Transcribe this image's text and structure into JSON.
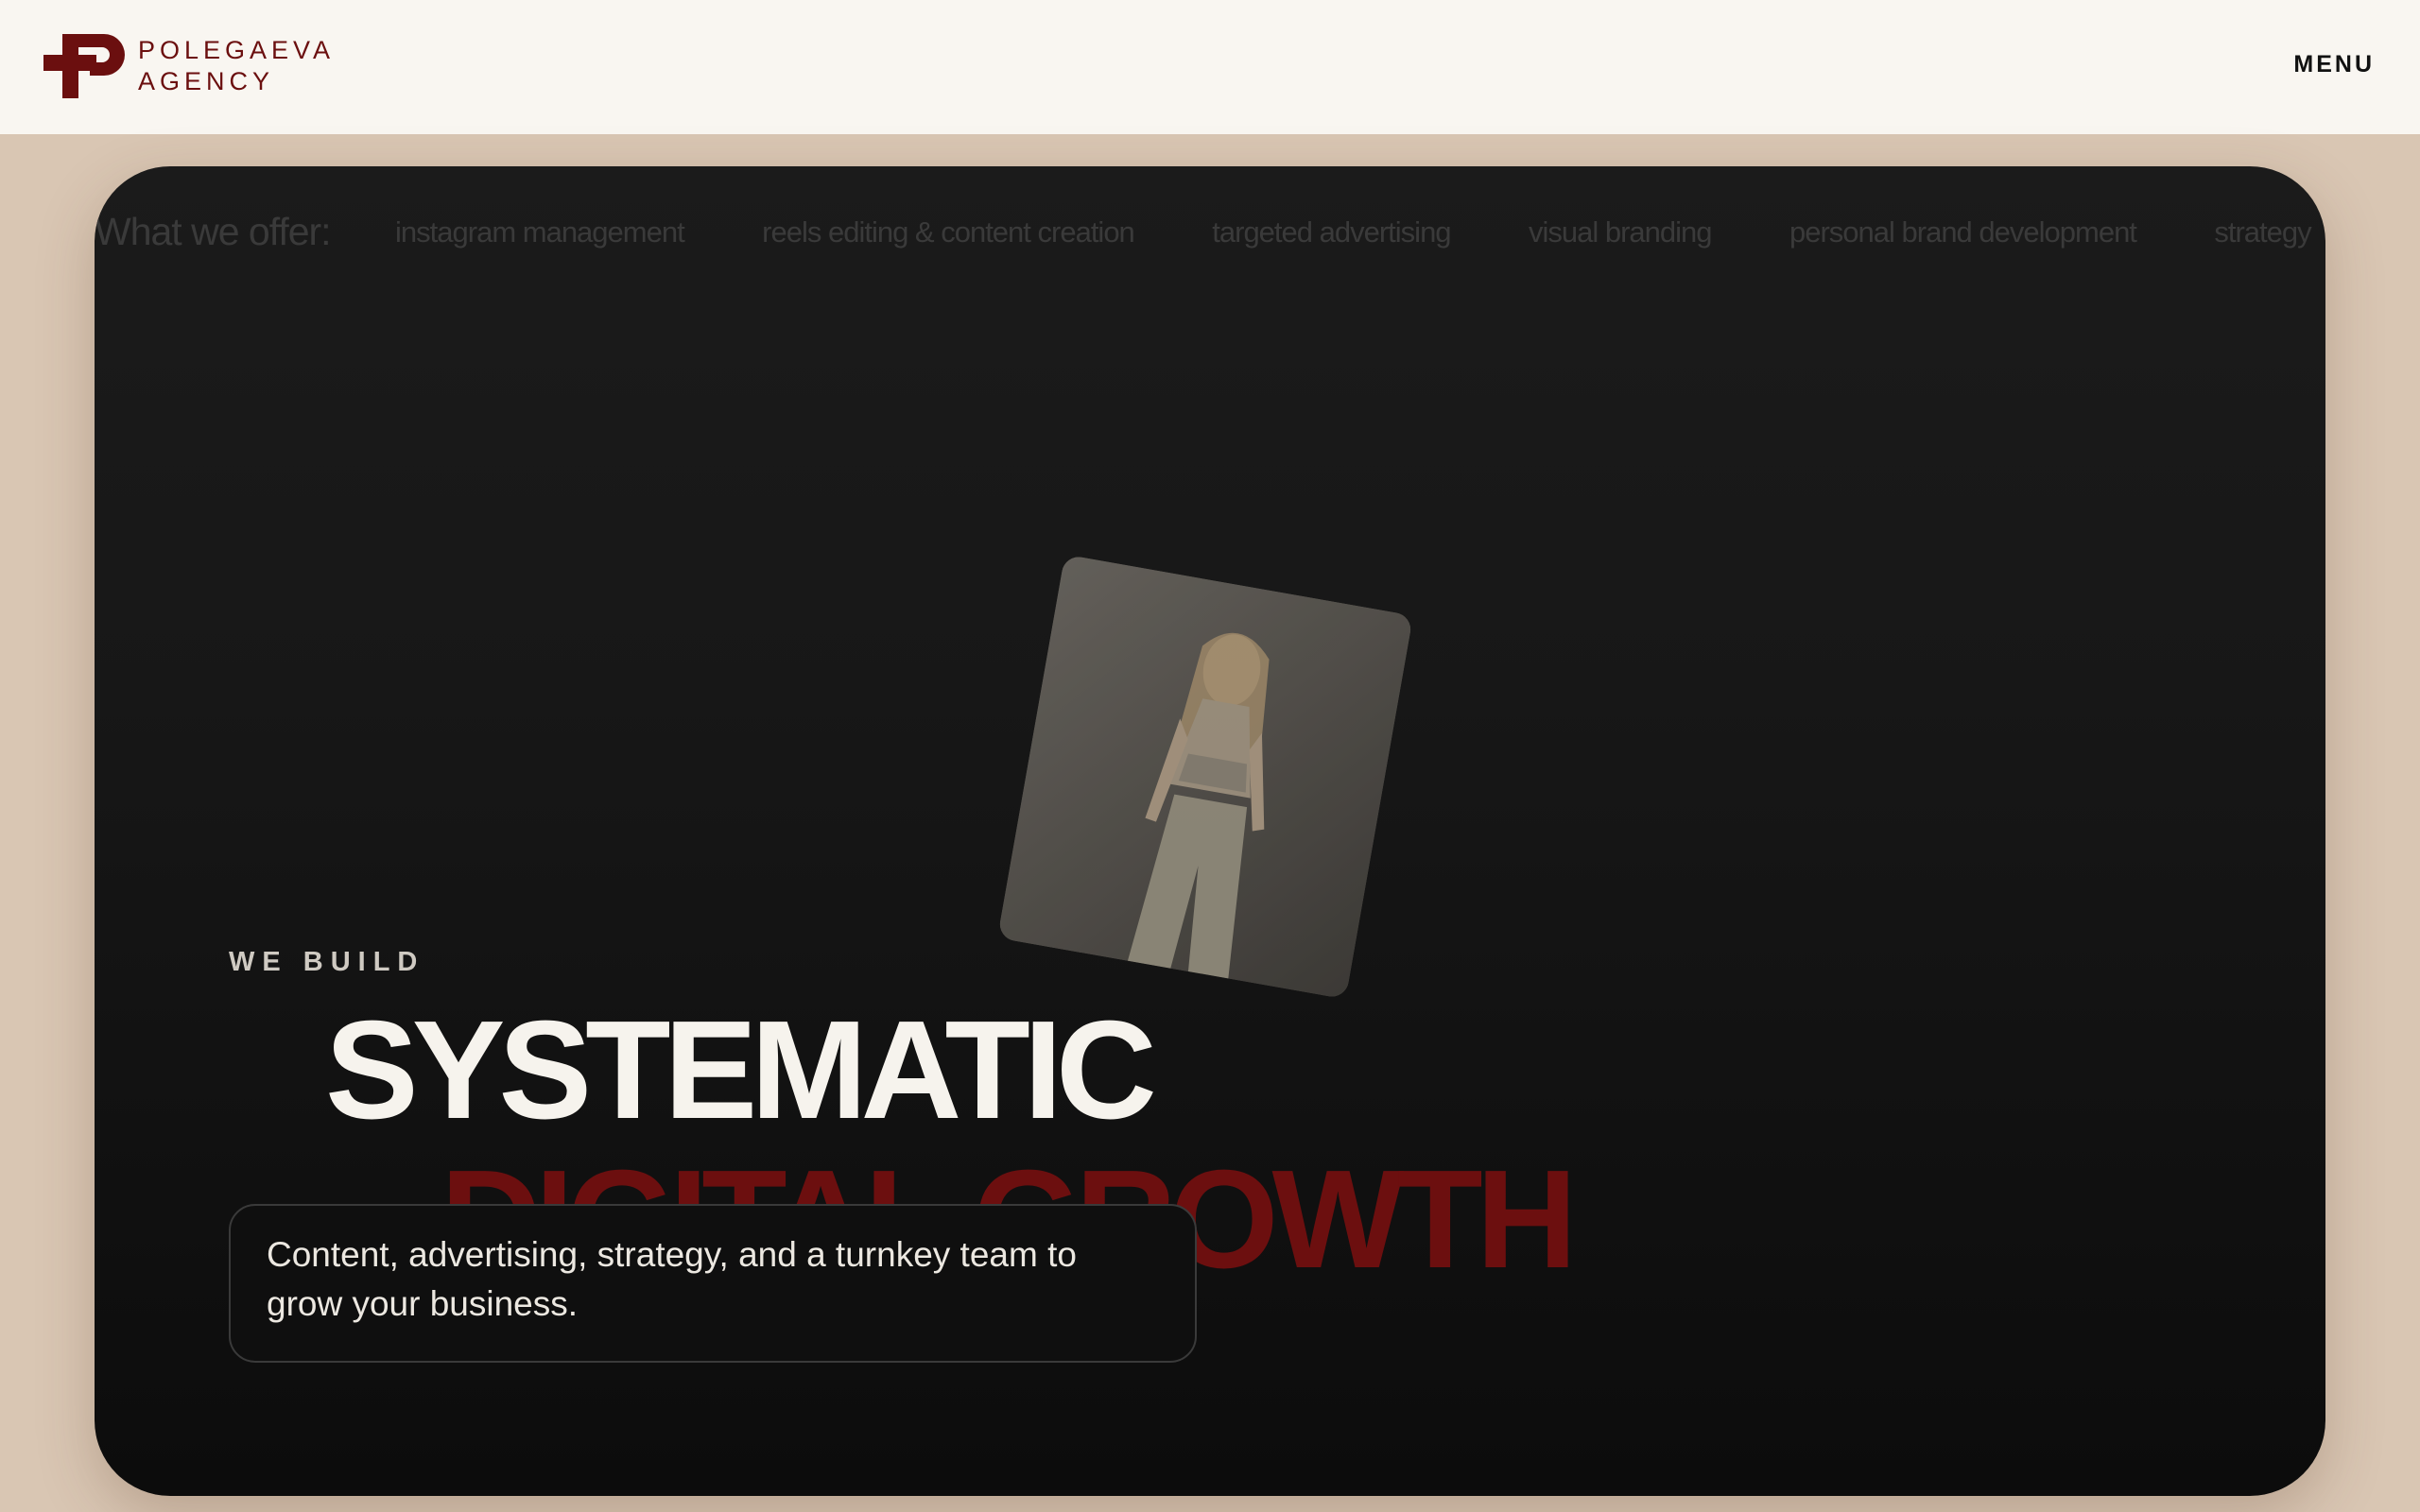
{
  "header": {
    "logo_line1": "POLEGAEVA",
    "logo_line2": "AGENCY",
    "menu_label": "MENU"
  },
  "ticker": {
    "title": "What we offer:",
    "items": [
      "instagram management",
      "reels editing & content creation",
      "targeted advertising",
      "visual branding",
      "personal brand development",
      "strategy"
    ]
  },
  "hero": {
    "eyebrow": "WE BUILD",
    "headline_line1": "SYSTEMATIC",
    "headline_line2": "DIGITAL GROWTH",
    "description": "Content, advertising, strategy, and a turnkey team to grow your business."
  },
  "colors": {
    "brand": "#6b0f0f",
    "header_bg": "#f9f6f1",
    "page_bg": "#d9c6b3",
    "card_bg": "#171717"
  },
  "icons": {
    "logo": "cross-p-logo-icon"
  }
}
